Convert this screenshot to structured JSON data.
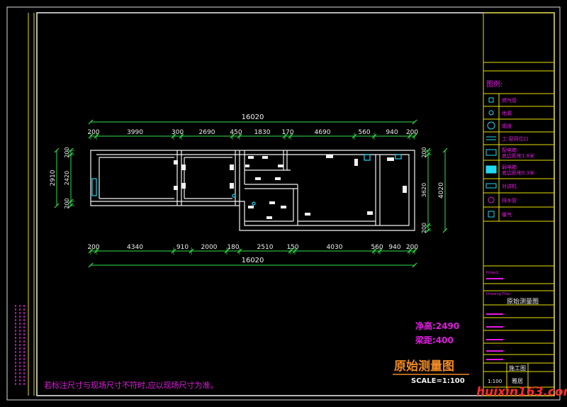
{
  "colors": {
    "background": "#000000",
    "frame": "#f0f0f0",
    "dimension": "#33e04a",
    "wall": "#f2f2f2",
    "titleblock_line": "#e8e000",
    "legend_icon": "#22d8f0",
    "magenta": "#e11ce1",
    "orange": "#f08a24",
    "watermark": "#ff2b2b"
  },
  "plan": {
    "top_total": "16020",
    "top_dims": [
      "200",
      "3990",
      "300",
      "2690",
      "450",
      "1830",
      "170",
      "4690",
      "560",
      "940",
      "200"
    ],
    "bottom_total": "16020",
    "bottom_dims": [
      "200",
      "4340",
      "910",
      "2000",
      "180",
      "2510",
      "150",
      "4030",
      "560",
      "940",
      "200"
    ],
    "left_total": "2910",
    "left_dims": [
      "200",
      "2420",
      "200"
    ],
    "right_total": "4020",
    "right_dims": [
      "200",
      "3620",
      "200"
    ]
  },
  "notes": {
    "ceiling_height": "净高:2490",
    "beam_distance": "梁距:400",
    "drawing_title": "原始测量图",
    "scale": "SCALE=1:100",
    "footnote": "若标注尺寸与现场尺寸不符时,应以现场尺寸为准。"
  },
  "legend": {
    "title": "图例:",
    "items": [
      {
        "icon": "gas-pipe-icon",
        "label": "燃气管"
      },
      {
        "icon": "floor-drain-icon",
        "label": "地漏"
      },
      {
        "icon": "exhaust-icon",
        "label": "烟道"
      },
      {
        "icon": "socket-icon",
        "label": "工:窗洞位口"
      },
      {
        "icon": "electric-box-icon",
        "label": "配电箱 底边距地1.8米"
      },
      {
        "icon": "weak-box-icon",
        "label": "弱电箱 底边距地0.3米"
      },
      {
        "icon": "intercom-icon",
        "label": "对讲机"
      },
      {
        "icon": "drain-pipe-icon",
        "label": "排水管"
      },
      {
        "icon": "heating-icon",
        "label": "暖气"
      }
    ]
  },
  "titleblock": {
    "project": "Project:",
    "drawing_title_label": "Drawing Title:",
    "drawing_title": "原始测量图",
    "scale_label": "1:100",
    "phase": "施工图",
    "brand": "雅居"
  },
  "watermark": "huixin163.com"
}
